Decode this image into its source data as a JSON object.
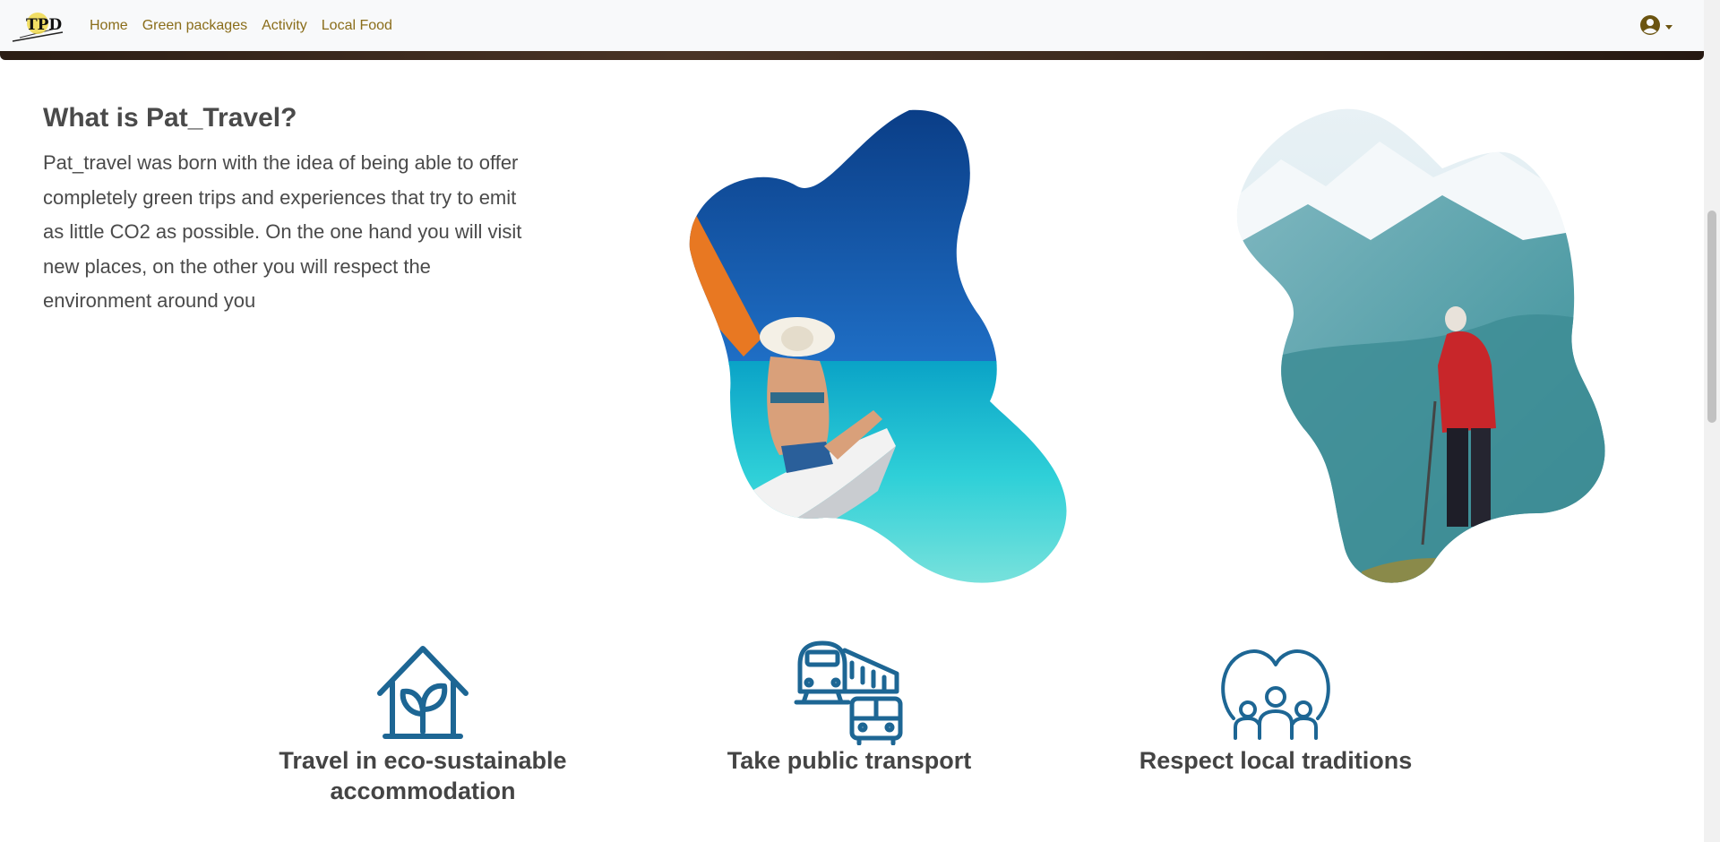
{
  "nav": {
    "logo_text": "TPD",
    "links": [
      "Home",
      "Green packages",
      "Activity",
      "Local Food"
    ]
  },
  "about": {
    "title": "What is Pat_Travel?",
    "text": "Pat_travel was born with the idea of being able to offer completely green trips and experiences that try to emit as little CO2 as possible. On the one hand you will visit new places, on the other you will respect the environment around you"
  },
  "features": [
    {
      "icon": "eco-house-icon",
      "label": "Travel in eco-sustainable accommodation"
    },
    {
      "icon": "train-bus-icon",
      "label": "Take public transport"
    },
    {
      "icon": "heart-family-icon",
      "label": "Respect local traditions"
    }
  ],
  "colors": {
    "nav_bg": "#f8f9fa",
    "nav_link": "#8a6d1a",
    "icon_blue": "#1d6694",
    "text": "#4a4a4a"
  }
}
